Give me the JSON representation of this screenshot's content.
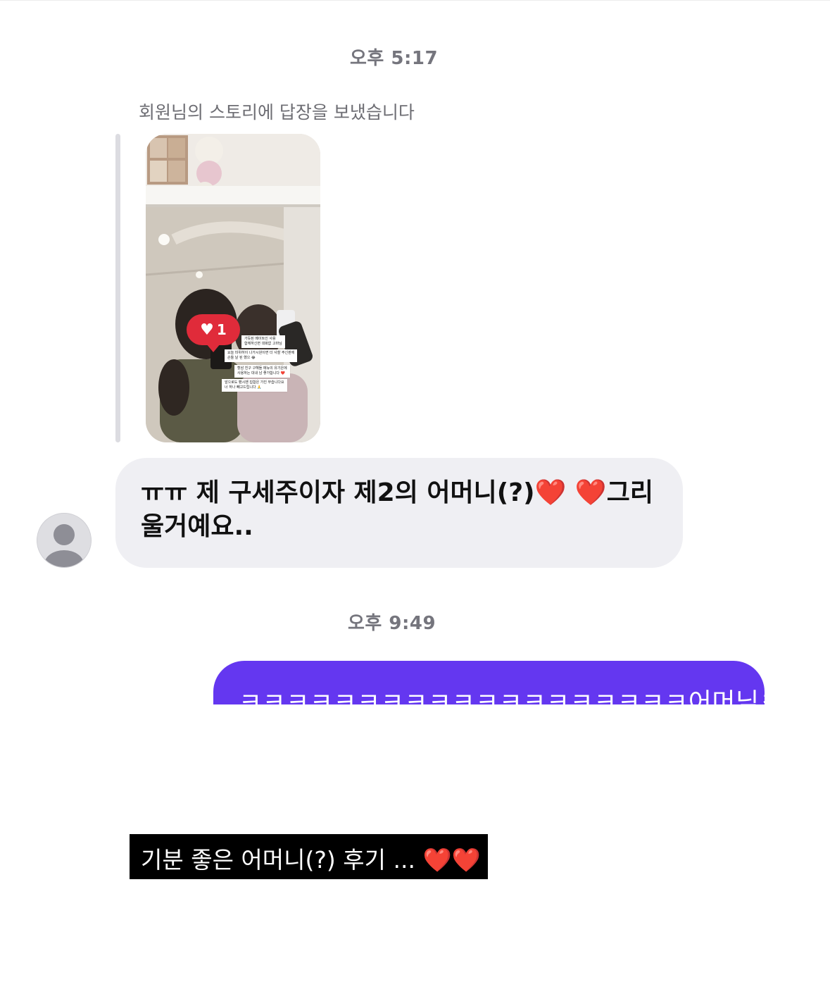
{
  "chat": {
    "timestamp_1": "오후 5:17",
    "story_reply_note": "회원님의 스토리에 답장을 보냈습니다",
    "story": {
      "like_count": "1",
      "captions": [
        "가듯된 메이트인 사용",
        "함께하신면 대화없 고마님",
        "요늘 미위하이 나가시원이면 더 사찰 주신판에",
        "손들 날 된 했으 😂",
        "할삼 친구 구해들 메뉴의 유기은에",
        "사용하는 대내 남 좋가합니다 ❤️",
        "앞으로도 팬시멘 집합은 가진 부습니다요",
        "너 하나 빼고드립니다 🙏"
      ]
    },
    "incoming_message": {
      "text_before_hearts": "ㅠㅠ 제 구세주이자 제2의 어머니(?)",
      "hearts": "❤️ ❤️",
      "text_after_hearts": "그리",
      "line_2": "울거예요.."
    },
    "timestamp_2": "오후 9:49",
    "outgoing_message": {
      "text": "ㅋㅋㅋㅋㅋㅋㅋㅋㅋㅋㅋㅋㅋㅋㅋㅋㅋㅋㅋ어머님ㅋ"
    }
  },
  "caption_overlay": {
    "text": "기분 좋은 어머니(?) 후기 ...",
    "hearts": "❤️❤️"
  },
  "colors": {
    "outgoing_bubble": "#6437f0",
    "incoming_bubble": "#efeff3",
    "like_badge": "#e02b3a",
    "caption_background": "#000000"
  },
  "icons": {
    "avatar": "default-user-avatar-icon",
    "like": "heart-icon"
  }
}
